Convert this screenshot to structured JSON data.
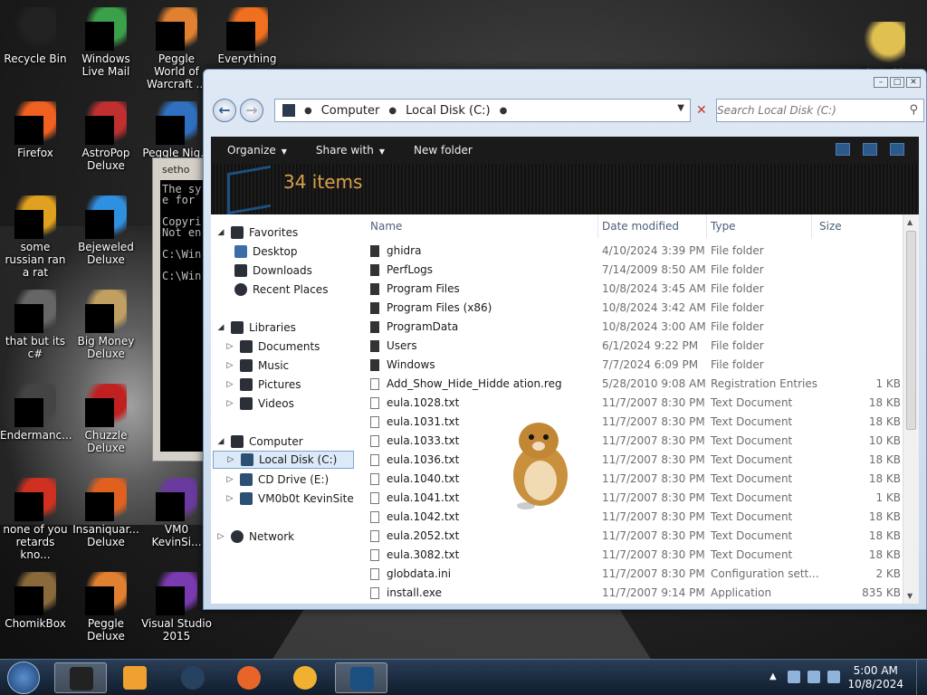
{
  "desktop": {
    "icons": [
      {
        "label": "Recycle Bin",
        "icon": "recycle-bin-icon"
      },
      {
        "label": "Windows Live Mail",
        "icon": "mail-icon"
      },
      {
        "label": "Peggle World of Warcraft ...",
        "icon": "peggle-icon"
      },
      {
        "label": "Everything",
        "icon": "everything-icon"
      },
      {
        "label": "Play This",
        "icon": "folder-icon"
      },
      {
        "label": "Firefox",
        "icon": "firefox-icon"
      },
      {
        "label": "AstroPop Deluxe",
        "icon": "astropop-icon"
      },
      {
        "label": "Peggle Nig...",
        "icon": "peggle-icon"
      },
      {
        "label": "some russian ran a rat",
        "icon": "rat-icon"
      },
      {
        "label": "Bejeweled Deluxe",
        "icon": "bejeweled-icon"
      },
      {
        "label": "that but its c#",
        "icon": "shortcut-icon"
      },
      {
        "label": "Big Money Deluxe",
        "icon": "bigmoney-icon"
      },
      {
        "label": "Endermanc...",
        "icon": "file-icon"
      },
      {
        "label": "Chuzzle Deluxe",
        "icon": "chuzzle-icon"
      },
      {
        "label": "none of you retards kno...",
        "icon": "file-icon"
      },
      {
        "label": "Insaniquar... Deluxe",
        "icon": "insaniquarium-icon"
      },
      {
        "label": "VM0 KevinSi...",
        "icon": "vm-icon"
      },
      {
        "label": "ChomikBox",
        "icon": "chomikbox-icon"
      },
      {
        "label": "Peggle Deluxe",
        "icon": "peggle-icon"
      },
      {
        "label": "Visual Studio 2015",
        "icon": "visual-studio-icon"
      }
    ],
    "console_title": "setho",
    "console_lines": "The sy\ne for\n\nCopyri\nNot en\n\nC:\\Win\n\nC:\\Win"
  },
  "explorer": {
    "address": {
      "seg1": "Computer",
      "seg2": "Local Disk (C:)"
    },
    "search_placeholder": "Search Local Disk (C:)",
    "toolbar": {
      "organize": "Organize",
      "share": "Share with",
      "new_folder": "New folder"
    },
    "item_count": "34 items",
    "nav": {
      "favorites": "Favorites",
      "desktop": "Desktop",
      "downloads": "Downloads",
      "recent": "Recent Places",
      "libraries": "Libraries",
      "documents": "Documents",
      "music": "Music",
      "pictures": "Pictures",
      "videos": "Videos",
      "computer": "Computer",
      "local_disk": "Local Disk (C:)",
      "cd_drive": "CD Drive (E:)",
      "vm": "VM0b0t KevinSite",
      "network": "Network"
    },
    "columns": {
      "name": "Name",
      "date": "Date modified",
      "type": "Type",
      "size": "Size"
    },
    "files": [
      {
        "name": "ghidra",
        "date": "4/10/2024 3:39 PM",
        "type": "File folder",
        "size": ""
      },
      {
        "name": "PerfLogs",
        "date": "7/14/2009 8:50 AM",
        "type": "File folder",
        "size": ""
      },
      {
        "name": "Program Files",
        "date": "10/8/2024 3:45 AM",
        "type": "File folder",
        "size": ""
      },
      {
        "name": "Program Files (x86)",
        "date": "10/8/2024 3:42 AM",
        "type": "File folder",
        "size": ""
      },
      {
        "name": "ProgramData",
        "date": "10/8/2024 3:00 AM",
        "type": "File folder",
        "size": ""
      },
      {
        "name": "Users",
        "date": "6/1/2024 9:22 PM",
        "type": "File folder",
        "size": ""
      },
      {
        "name": "Windows",
        "date": "7/7/2024 6:09 PM",
        "type": "File folder",
        "size": ""
      },
      {
        "name": "Add_Show_Hide_Hidde       ation.reg",
        "date": "5/28/2010 9:08 AM",
        "type": "Registration Entries",
        "size": "1 KB"
      },
      {
        "name": "eula.1028.txt",
        "date": "11/7/2007 8:30 PM",
        "type": "Text Document",
        "size": "18 KB"
      },
      {
        "name": "eula.1031.txt",
        "date": "11/7/2007 8:30 PM",
        "type": "Text Document",
        "size": "18 KB"
      },
      {
        "name": "eula.1033.txt",
        "date": "11/7/2007 8:30 PM",
        "type": "Text Document",
        "size": "10 KB"
      },
      {
        "name": "eula.1036.txt",
        "date": "11/7/2007 8:30 PM",
        "type": "Text Document",
        "size": "18 KB"
      },
      {
        "name": "eula.1040.txt",
        "date": "11/7/2007 8:30 PM",
        "type": "Text Document",
        "size": "18 KB"
      },
      {
        "name": "eula.1041.txt",
        "date": "11/7/2007 8:30 PM",
        "type": "Text Document",
        "size": "1 KB"
      },
      {
        "name": "eula.1042.txt",
        "date": "11/7/2007 8:30 PM",
        "type": "Text Document",
        "size": "18 KB"
      },
      {
        "name": "eula.2052.txt",
        "date": "11/7/2007 8:30 PM",
        "type": "Text Document",
        "size": "18 KB"
      },
      {
        "name": "eula.3082.txt",
        "date": "11/7/2007 8:30 PM",
        "type": "Text Document",
        "size": "18 KB"
      },
      {
        "name": "globdata.ini",
        "date": "11/7/2007 8:30 PM",
        "type": "Configuration sett...",
        "size": "2 KB"
      },
      {
        "name": "install.exe",
        "date": "11/7/2007 9:14 PM",
        "type": "Application",
        "size": "835 KB"
      }
    ]
  },
  "taskbar": {
    "time": "5:00 AM",
    "date": "10/8/2024"
  }
}
